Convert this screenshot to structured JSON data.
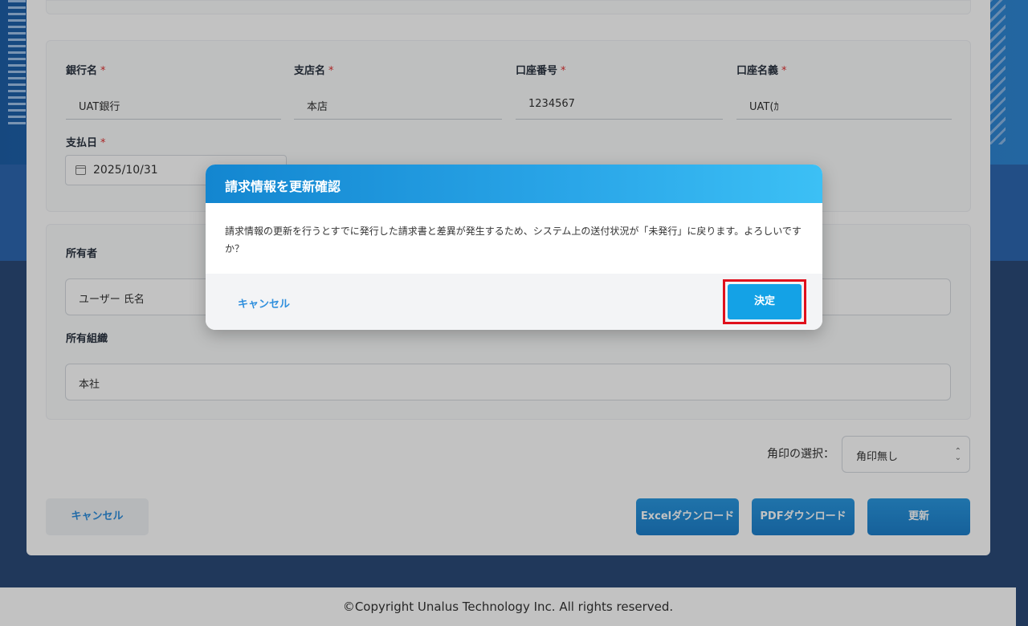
{
  "bank": {
    "bank_name_label": "銀行名",
    "bank_name_value": "UAT銀行",
    "branch_label": "支店名",
    "branch_value": "本店",
    "account_number_label": "口座番号",
    "account_number_value": "1234567",
    "account_holder_label": "口座名義",
    "account_holder_value": "UAT(ｶ",
    "payment_date_label": "支払日",
    "payment_date_value": "2025/10/31",
    "required_mark": "*"
  },
  "owner": {
    "owner_label": "所有者",
    "owner_value": "ユーザー 氏名",
    "org_label": "所有組織",
    "org_value": "本社"
  },
  "stamp": {
    "label": "角印の選択：",
    "selected": "角印無し"
  },
  "actions": {
    "cancel": "キャンセル",
    "excel": "Excelダウンロード",
    "pdf": "PDFダウンロード",
    "update": "更新"
  },
  "footer": {
    "copyright": "©Copyright Unalus Technology Inc. All rights reserved."
  },
  "modal": {
    "title": "請求情報を更新確認",
    "message": "請求情報の更新を行うとすでに発行した請求書と差異が発生するため、システム上の送付状況が「未発行」に戻ります。よろしいですか？",
    "cancel": "キャンセル",
    "confirm": "決定"
  },
  "colors": {
    "accent": "#14a2e6",
    "highlight": "#e0101c"
  }
}
